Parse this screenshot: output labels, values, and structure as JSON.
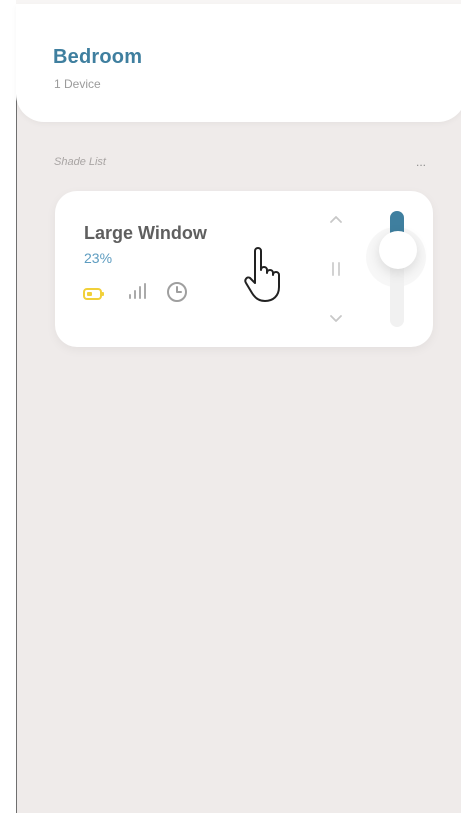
{
  "header": {
    "room_title": "Bedroom",
    "device_count": "1 Device"
  },
  "section": {
    "label": "Shade List",
    "more_label": "..."
  },
  "shade": {
    "name": "Large Window",
    "position_text": "23%",
    "position_value": 23,
    "status_icons": [
      "battery-icon",
      "signal-icon",
      "clock-icon"
    ],
    "controls": [
      "chevron-up-icon",
      "pause-icon",
      "chevron-down-icon"
    ]
  },
  "colors": {
    "background": "#efebea",
    "card": "#ffffff",
    "title_blue": "#3f7f9f",
    "percent_blue": "#5d9cc0",
    "battery_yellow": "#f1d03a",
    "gray_text": "#5f5f5f"
  }
}
